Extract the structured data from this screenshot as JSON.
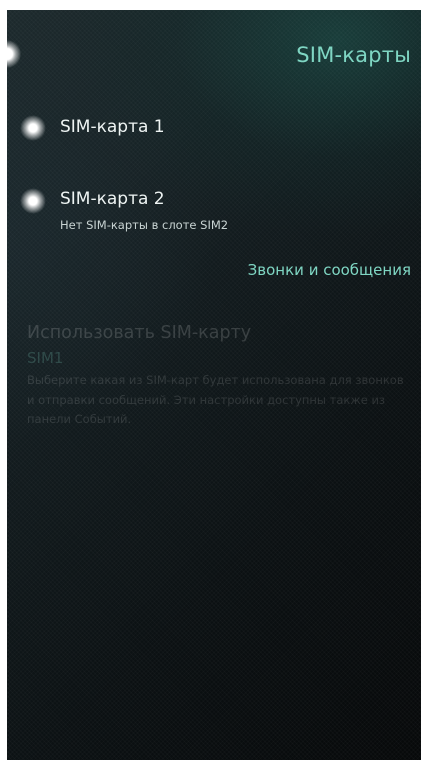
{
  "header": {
    "title": "SIM-карты",
    "accent_color": "#7fd6c3"
  },
  "sims": [
    {
      "label": "SIM-карта 1",
      "status": "",
      "icon": "glow-dot-icon"
    },
    {
      "label": "SIM-карта 2",
      "status": "Нет SIM-карты в слоте SIM2",
      "icon": "glow-dot-icon"
    }
  ],
  "calls_link": {
    "label": "Звонки и сообщения"
  },
  "use_sim": {
    "label": "Использовать SIM-карту",
    "value": "SIM1",
    "description": "Выберите какая из SIM-карт будет использована для звонков и отправки сообщений. Эти настройки доступны также из панели Событий.",
    "disabled": true
  }
}
